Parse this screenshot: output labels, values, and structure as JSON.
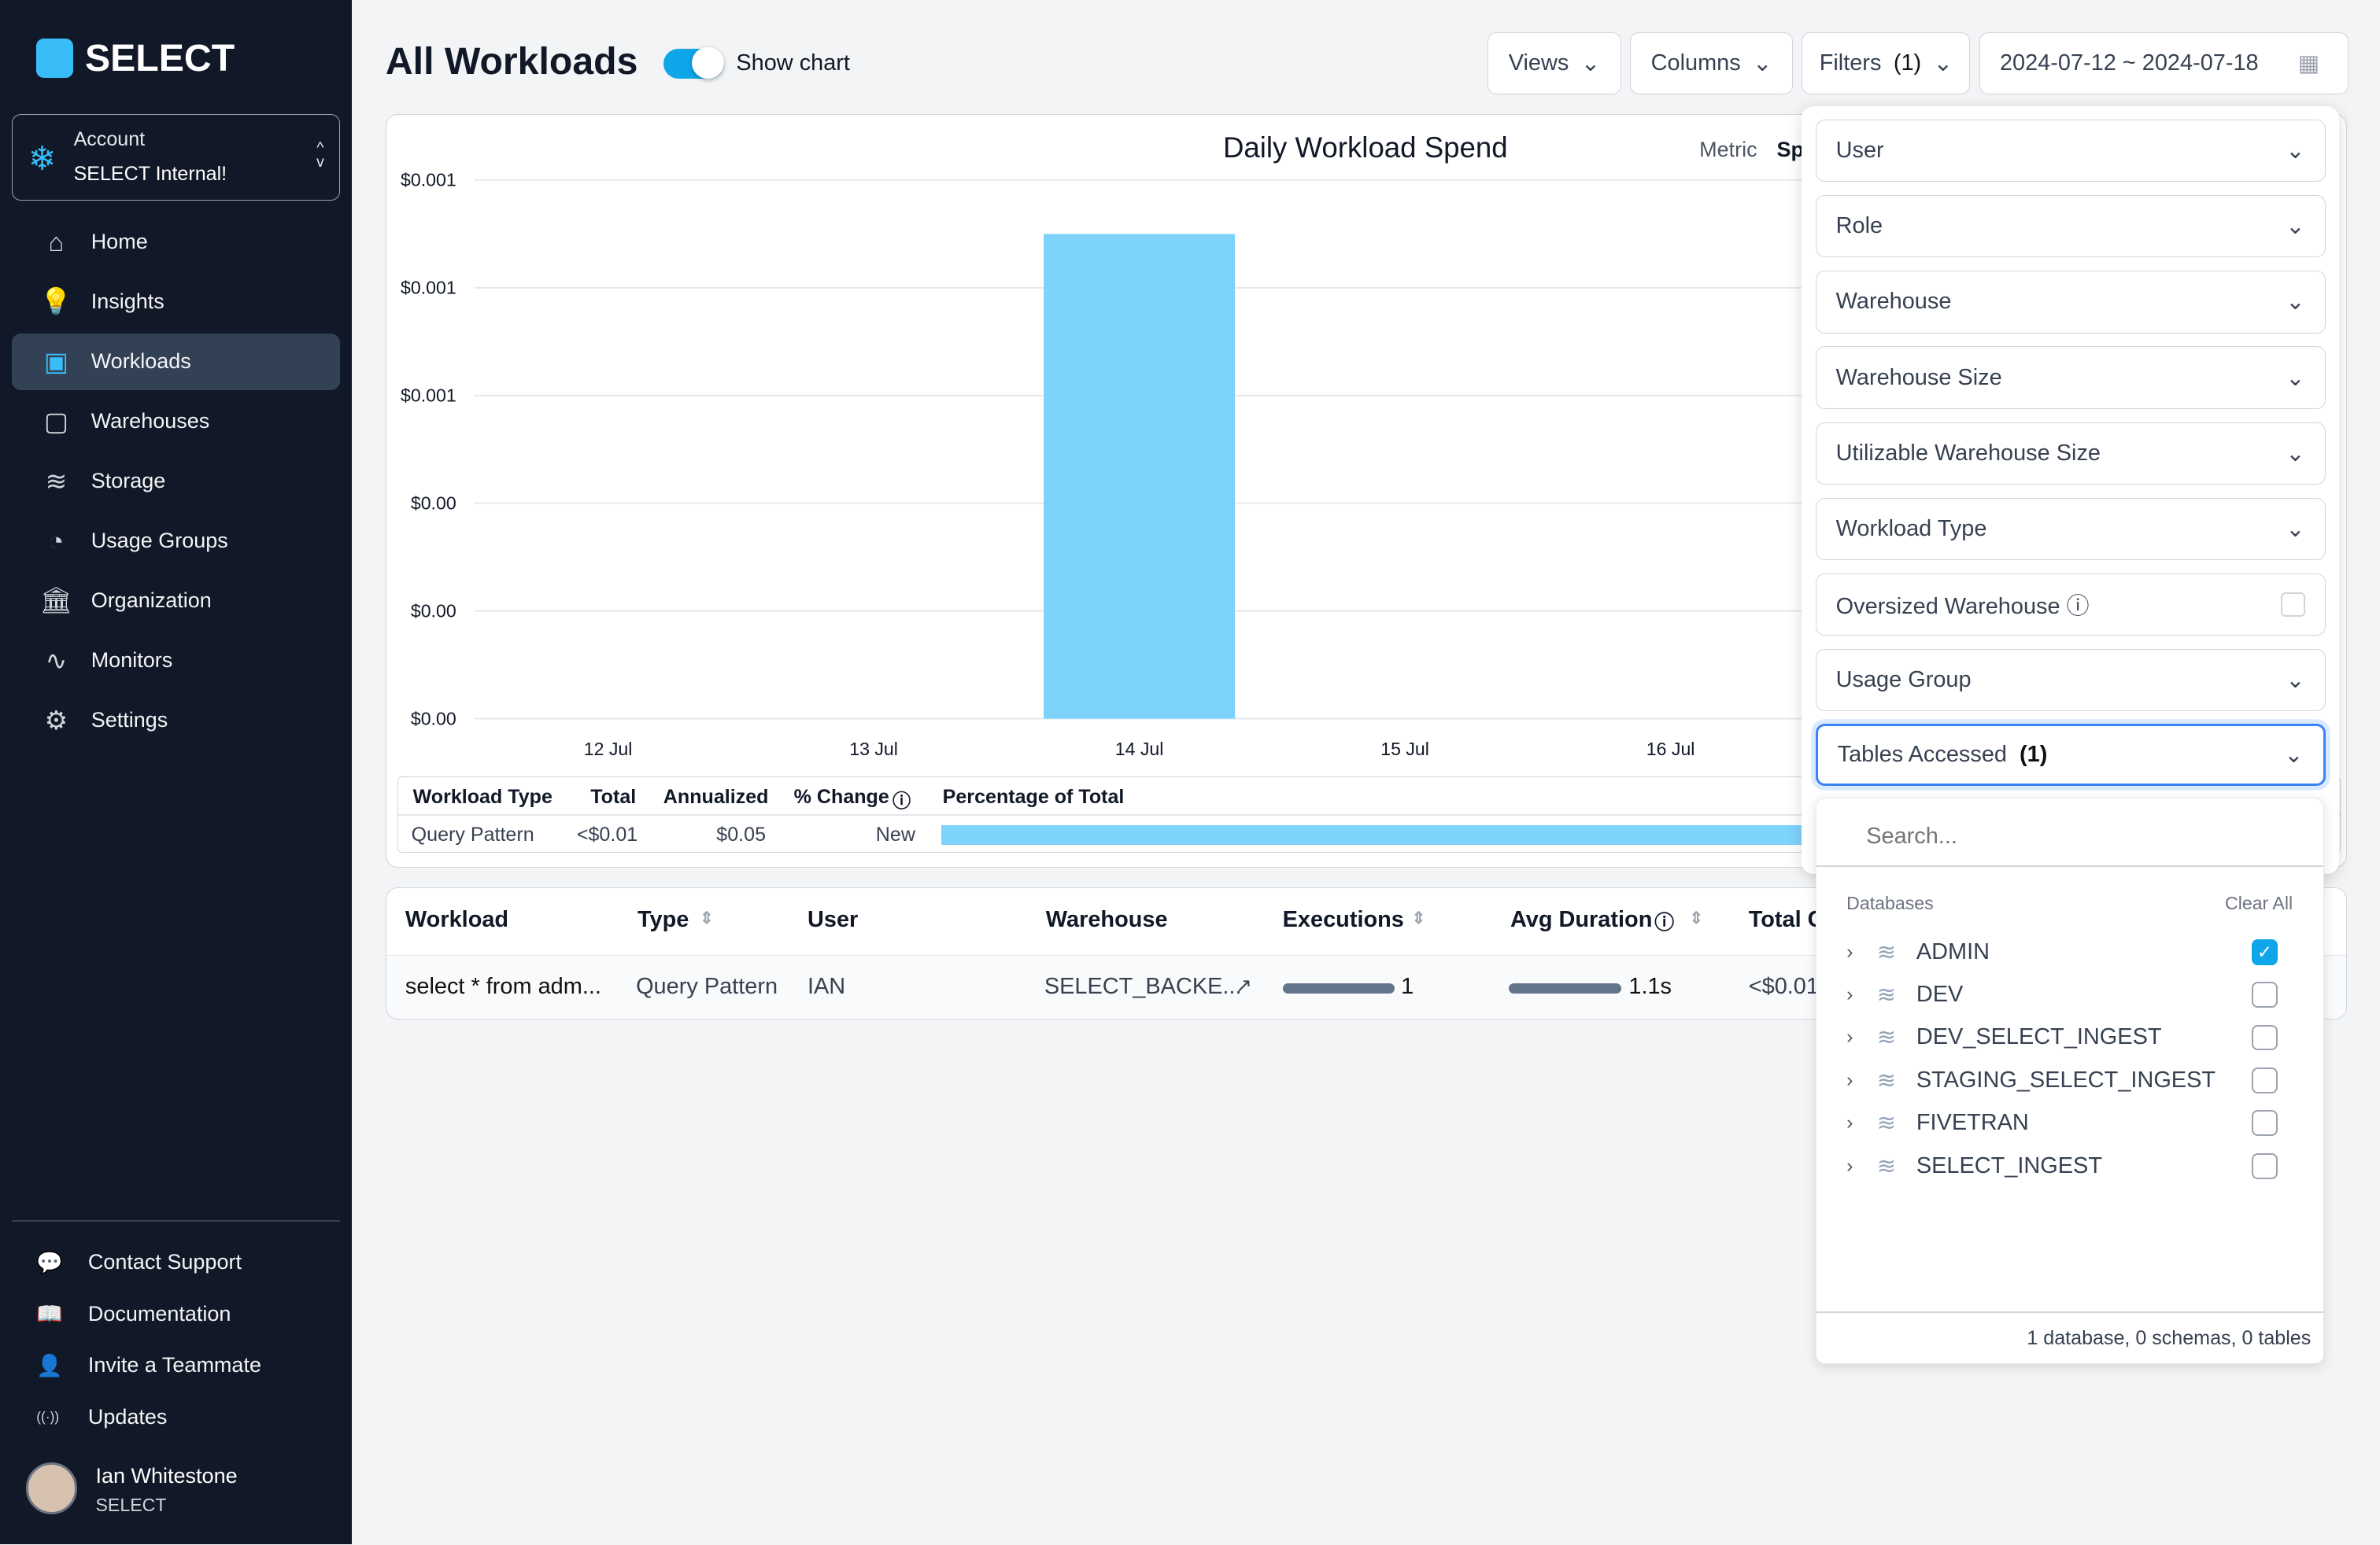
{
  "brand": {
    "name": "SELECT",
    "accent": "#38bdf8"
  },
  "account": {
    "label": "Account",
    "name": "SELECT Internal!"
  },
  "nav": [
    {
      "label": "Home",
      "icon": "home-icon"
    },
    {
      "label": "Insights",
      "icon": "lightbulb-icon"
    },
    {
      "label": "Workloads",
      "icon": "workloads-icon",
      "active": true
    },
    {
      "label": "Warehouses",
      "icon": "chip-icon"
    },
    {
      "label": "Storage",
      "icon": "database-icon"
    },
    {
      "label": "Usage Groups",
      "icon": "pie-icon"
    },
    {
      "label": "Organization",
      "icon": "bank-icon"
    },
    {
      "label": "Monitors",
      "icon": "pulse-icon"
    },
    {
      "label": "Settings",
      "icon": "gear-icon"
    }
  ],
  "bottom_nav": [
    {
      "label": "Contact Support"
    },
    {
      "label": "Documentation"
    },
    {
      "label": "Invite a Teammate"
    },
    {
      "label": "Updates"
    }
  ],
  "user": {
    "name": "Ian Whitestone",
    "org": "SELECT"
  },
  "header": {
    "title": "All Workloads",
    "show_chart": "Show chart",
    "show_chart_on": true,
    "views": "Views",
    "columns": "Columns",
    "filters": "Filters",
    "filters_count": "(1)",
    "date_range": "2024-07-12 ~ 2024-07-18"
  },
  "chart_data": {
    "type": "bar",
    "title": "Daily Workload Spend",
    "metric_label": "Metric",
    "metric_value": "Sp",
    "categories": [
      "12 Jul",
      "13 Jul",
      "14 Jul",
      "15 Jul",
      "16 Jul"
    ],
    "values": [
      0,
      0,
      0.0009,
      0,
      0
    ],
    "ytick_values": [
      0,
      0.0002,
      0.0004,
      0.0006,
      0.0008,
      0.001
    ],
    "ytick_labels": [
      "$0.00",
      "$0.00",
      "$0.00",
      "$0.001",
      "$0.001",
      "$0.001"
    ],
    "ylim": [
      0,
      0.001
    ],
    "color": "#7dd3fc",
    "grid": true
  },
  "summary": {
    "headers": [
      "Workload Type",
      "Total",
      "Annualized",
      "% Change",
      "Percentage of Total"
    ],
    "row": [
      "Query Pattern",
      "<$0.01",
      "$0.05",
      "New"
    ],
    "percentage": 100
  },
  "table": {
    "headers": [
      "Workload",
      "Type",
      "User",
      "Warehouse",
      "Executions",
      "Avg Duration",
      "Total C"
    ],
    "rows": [
      {
        "workload": "select * from adm...",
        "type": "Query Pattern",
        "user": "IAN",
        "warehouse": "SELECT_BACKE...",
        "executions": "1",
        "avg_duration": "1.1s",
        "total": "<$0.01"
      }
    ]
  },
  "filters": {
    "items": [
      "User",
      "Role",
      "Warehouse",
      "Warehouse Size",
      "Utilizable Warehouse Size",
      "Workload Type",
      "Oversized Warehouse",
      "Usage Group"
    ],
    "tables_accessed": "Tables Accessed",
    "tables_accessed_count": "(1)"
  },
  "dropdown": {
    "search_placeholder": "Search...",
    "section": "Databases",
    "clear_all": "Clear All",
    "databases": [
      {
        "name": "ADMIN",
        "checked": true
      },
      {
        "name": "DEV",
        "checked": false
      },
      {
        "name": "DEV_SELECT_INGEST",
        "checked": false
      },
      {
        "name": "STAGING_SELECT_INGEST",
        "checked": false
      },
      {
        "name": "FIVETRAN",
        "checked": false
      },
      {
        "name": "SELECT_INGEST",
        "checked": false
      }
    ],
    "footer": "1 database, 0 schemas, 0 tables"
  }
}
